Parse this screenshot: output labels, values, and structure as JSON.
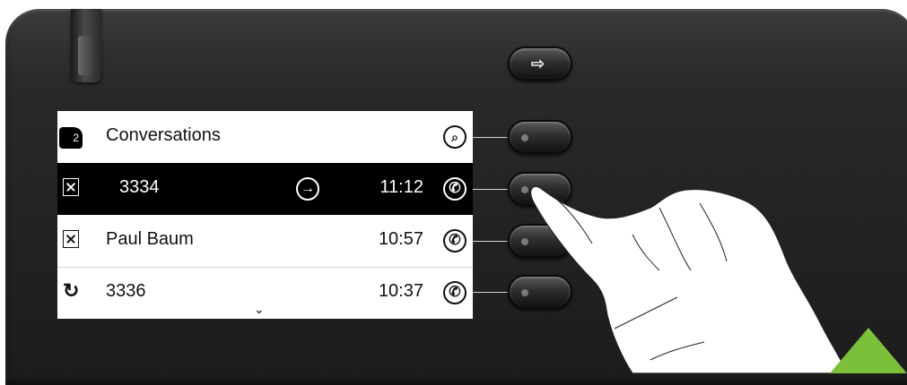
{
  "display": {
    "header": {
      "badge": "2",
      "title": "Conversations",
      "softkey_icon": "search-icon"
    },
    "rows": [
      {
        "state": "selected",
        "status_icon": "missed-call-icon",
        "label": "3334",
        "forward_icon": "forward-arrow-icon",
        "time": "11:12",
        "softkey_icon": "phone-icon"
      },
      {
        "state": "normal",
        "status_icon": "missed-call-icon",
        "label": "Paul Baum",
        "time": "10:57",
        "softkey_icon": "phone-icon"
      },
      {
        "state": "normal",
        "status_icon": "dialed-call-icon",
        "label": "3336",
        "time": "10:37",
        "softkey_icon": "phone-icon"
      }
    ],
    "more_indicator": "⌄"
  },
  "hardware": {
    "exit_key_icon": "exit-icon",
    "exit_glyph": "⇨",
    "colors": {
      "body": "#222224",
      "display_selected_bg": "#000000",
      "accent_triangle": "#7bbf3a"
    }
  }
}
